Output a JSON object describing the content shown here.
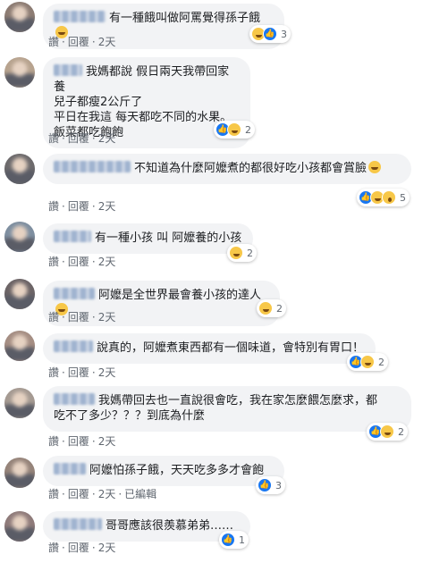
{
  "actions": {
    "like": "讚",
    "reply": "回覆",
    "sep": "·"
  },
  "comments": [
    {
      "text": "有一種餓叫做阿罵覺得孫子餓",
      "time": "2天",
      "reaction_count": "3",
      "reactions": [
        "haha-icon",
        "like-icon"
      ],
      "emoji": true
    },
    {
      "text": "我媽都說 假日兩天我帶回家養\n兒子都瘦2公斤了\n平日在我這 每天都吃不同的水果。\n飯菜都吃飽飽",
      "time": "2天",
      "reaction_count": "2",
      "reactions": [
        "like-icon",
        "haha-icon"
      ],
      "emoji": false
    },
    {
      "text": "不知道為什麼阿嬤煮的都很好吃小孩都會賞臉",
      "time": "2天",
      "reaction_count": "5",
      "reactions": [
        "like-icon",
        "haha-icon",
        "wow-icon"
      ],
      "emoji": true
    },
    {
      "text": "有一種小孩 叫 阿嬤養的小孩",
      "time": "2天",
      "reaction_count": "2",
      "reactions": [
        "haha-icon"
      ],
      "emoji": false
    },
    {
      "text": "阿嬤是全世界最會養小孩的達人",
      "time": "2天",
      "reaction_count": "2",
      "reactions": [
        "haha-icon"
      ],
      "emoji": true
    },
    {
      "text": "說真的，阿嬤煮東西都有一個味道，會特別有胃口！",
      "time": "2天",
      "reaction_count": "2",
      "reactions": [
        "like-icon",
        "haha-icon"
      ],
      "emoji": false
    },
    {
      "text": "我媽帶回去也一直說很會吃，我在家怎麼餵怎麼求，都\n吃不了多少？？？到底為什麼",
      "time": "2天",
      "reaction_count": "2",
      "reactions": [
        "like-icon",
        "haha-icon"
      ],
      "emoji": false
    },
    {
      "text": "阿嬤怕孫子餓，天天吃多多才會飽",
      "time": "2天",
      "edited": "已編輯",
      "reaction_count": "3",
      "reactions": [
        "like-icon"
      ],
      "emoji": false
    },
    {
      "text": "哥哥應該很羨慕弟弟……",
      "time": "2天",
      "reaction_count": "1",
      "reactions": [
        "like-icon"
      ],
      "emoji": false
    }
  ],
  "colors": {
    "bubble": "#f2f3f5",
    "like": "#1877f2",
    "haha": "#f7c748"
  }
}
